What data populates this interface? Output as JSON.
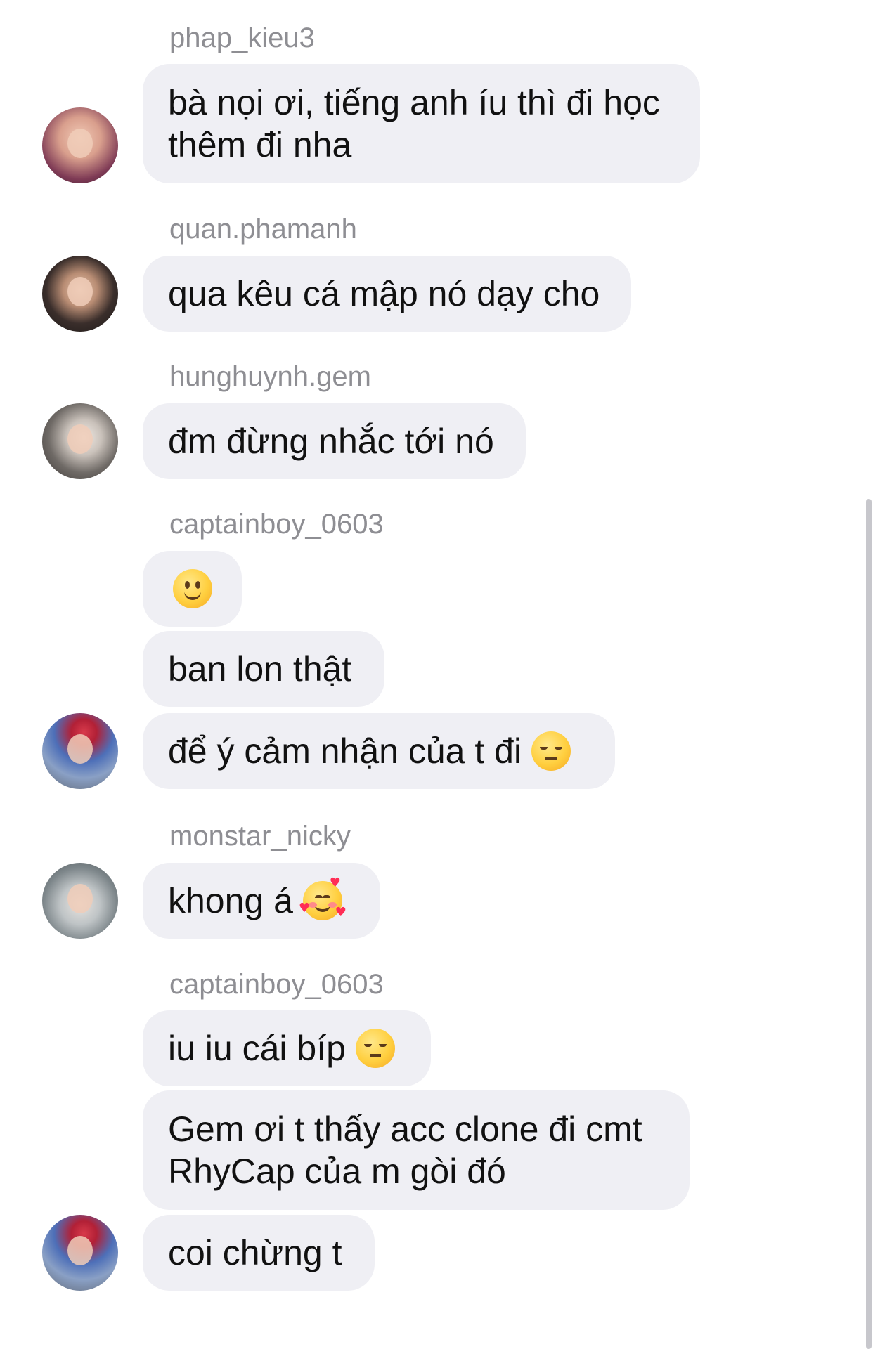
{
  "messages": [
    {
      "sender": "phap_kieu3",
      "text": "bà nọi ơi, tiếng anh íu thì đi học\nthêm đi nha"
    },
    {
      "sender": "quan.phamanh",
      "text": "qua kêu cá mập nó dạy cho"
    },
    {
      "sender": "hunghuynh.gem",
      "text": "đm đừng nhắc tới nó"
    },
    {
      "sender": "captainboy_0603",
      "emoji": "slightly-smiling-face-emoji"
    },
    {
      "text": "ban lon thật"
    },
    {
      "text": "để ý cảm nhận của t đi",
      "emoji": "pensive-face-emoji"
    },
    {
      "sender": "monstar_nicky",
      "text": "khong á",
      "emoji": "smiling-face-with-hearts-emoji"
    },
    {
      "sender": "captainboy_0603",
      "text": "iu iu cái bíp",
      "emoji": "pensive-face-emoji"
    },
    {
      "text": "Gem ơi t thấy acc clone đi cmt\nRhyCap của m gòi đó"
    },
    {
      "text": "coi chừng t"
    }
  ],
  "colors": {
    "bubble_background": "#efeff4",
    "sender_name": "#8e8e93",
    "message_text": "#111111",
    "scrollbar": "#c7c7cc"
  }
}
